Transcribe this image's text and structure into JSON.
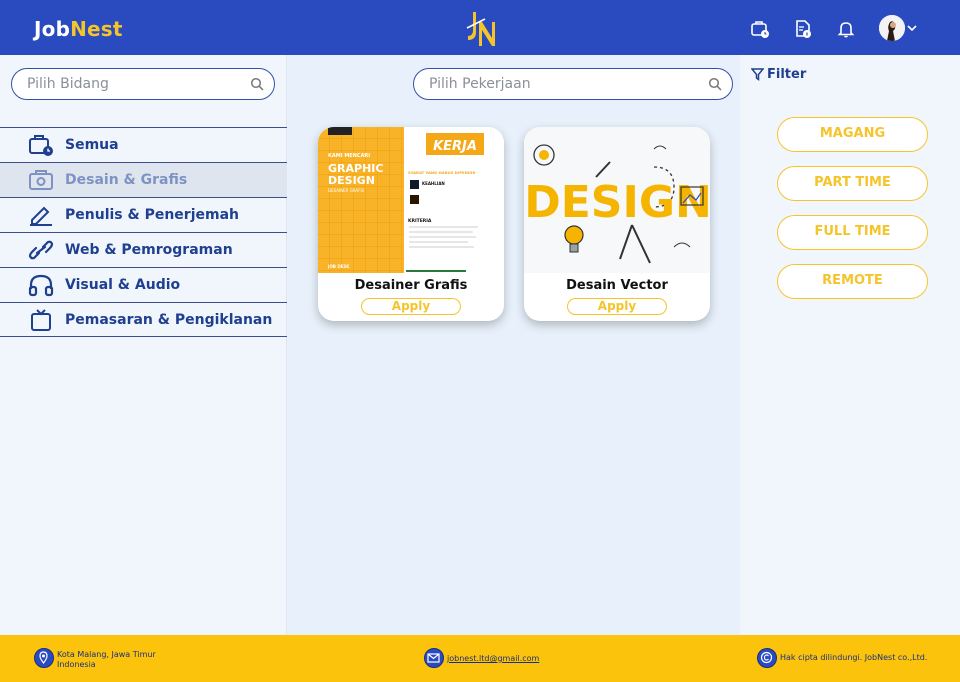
{
  "header": {
    "brand_part1": "Job",
    "brand_part2": "Nest",
    "icons": [
      "briefcase-clock-icon",
      "document-info-icon",
      "bell-icon",
      "avatar",
      "chevron-down-icon"
    ]
  },
  "left_search": {
    "placeholder": "Pilih Bidang"
  },
  "main_search": {
    "placeholder": "Pilih Pekerjaan"
  },
  "categories": [
    {
      "label": "Semua",
      "icon": "briefcase-clock-icon",
      "active": false
    },
    {
      "label": "Desain & Grafis",
      "icon": "camera-bag-icon",
      "active": true
    },
    {
      "label": "Penulis & Penerjemah",
      "icon": "pen-icon",
      "active": false
    },
    {
      "label": "Web & Pemrograman",
      "icon": "link-icon",
      "active": false
    },
    {
      "label": "Visual & Audio",
      "icon": "headphones-icon",
      "active": false
    },
    {
      "label": "Pemasaran & Pengiklanan",
      "icon": "tv-icon",
      "active": false
    }
  ],
  "jobs": [
    {
      "title": "Desainer Grafis",
      "apply_label": "Apply",
      "poster": {
        "kerja": "KERJA",
        "kami_mencari": "KAMI MENCARI",
        "graphic": "GRAPHIC",
        "design": "DESIGN",
        "desainer_grafis": "DESAINER GRAFIS",
        "syarat": "SYARAT YANG HARUS DIPENUHI",
        "keahlian": "KEAHLIAN",
        "kriteria": "KRITERIA",
        "job_desk": "JOB DESK"
      }
    },
    {
      "title": "Desain Vector",
      "apply_label": "Apply",
      "poster": {
        "word": "DESIGN"
      }
    }
  ],
  "filter": {
    "label": "Filter",
    "options": [
      "MAGANG",
      "PART TIME",
      "FULL TIME",
      "REMOTE"
    ]
  },
  "footer": {
    "location_line1": "Kota Malang, Jawa Timur",
    "location_line2": "Indonesia",
    "email": "jobnest.ltd@gmail.com",
    "copyright": "Hak cipta dilindungi. JobNest co.,Ltd."
  },
  "colors": {
    "primary": "#2a4bbf",
    "accent": "#f5c42a",
    "footer": "#fbc30b",
    "text_dark_blue": "#1f3f8f"
  }
}
